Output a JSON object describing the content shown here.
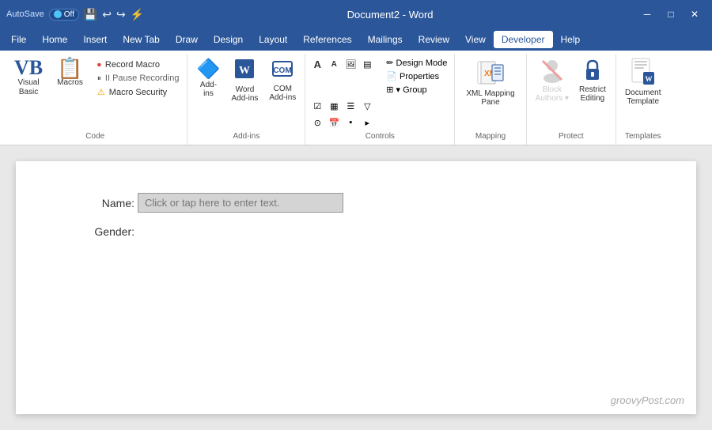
{
  "titlebar": {
    "autosave_label": "AutoSave",
    "autosave_state": "Off",
    "title": "Document2 - Word",
    "save_icon": "💾",
    "undo_icon": "↩",
    "redo_icon": "↪",
    "customize_icon": "⚡"
  },
  "menubar": {
    "items": [
      "File",
      "Home",
      "Insert",
      "New Tab",
      "Draw",
      "Design",
      "Layout",
      "References",
      "Mailings",
      "Review",
      "View",
      "Developer",
      "Help"
    ],
    "active": "Developer"
  },
  "ribbon": {
    "groups": {
      "code": {
        "label": "Code",
        "vb_label_line1": "Visual",
        "vb_label_line2": "Basic",
        "macros_label": "Macros",
        "record_label": "Record Macro",
        "pause_label": "II Pause Recording",
        "security_label": "Macro Security"
      },
      "addins": {
        "label": "Add-ins",
        "word_label": "Word\nAdd-ins",
        "com_label": "COM\nAdd-ins",
        "addins_label": "Add-\nins"
      },
      "controls": {
        "label": "Controls",
        "design_mode": "Design Mode",
        "properties": "Properties",
        "group": "▾ Group"
      },
      "mapping": {
        "label": "Mapping",
        "xml_label": "XML Mapping\nPane"
      },
      "protect": {
        "label": "Protect",
        "block_label_line1": "Block",
        "block_label_line2": "Authors",
        "restrict_label_line1": "Restrict",
        "restrict_label_line2": "Editing"
      },
      "templates": {
        "label": "Templates",
        "doc_label_line1": "Document",
        "doc_label_line2": "Template"
      }
    }
  },
  "document": {
    "name_label": "Name:",
    "name_placeholder": "Click or tap here to enter text.",
    "gender_label": "Gender:",
    "watermark": "groovyPost.com"
  },
  "window_controls": {
    "minimize": "─",
    "maximize": "□",
    "close": "✕"
  }
}
